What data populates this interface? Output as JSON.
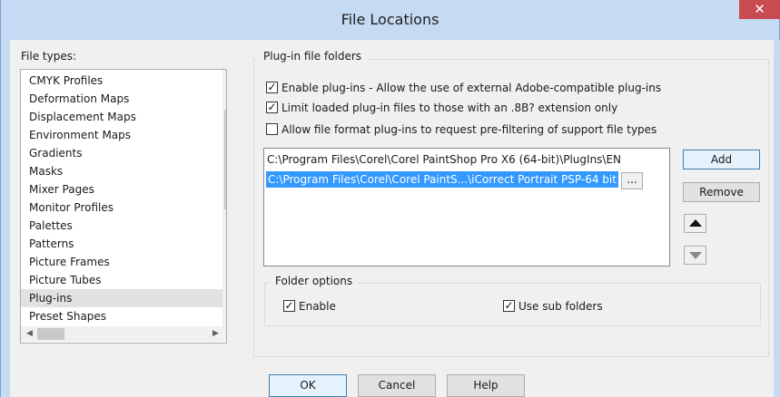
{
  "window": {
    "title": "File Locations",
    "close_glyph": "✕"
  },
  "file_types": {
    "label": "File types:",
    "items": [
      "CMYK Profiles",
      "Deformation Maps",
      "Displacement Maps",
      "Environment Maps",
      "Gradients",
      "Masks",
      "Mixer Pages",
      "Monitor Profiles",
      "Palettes",
      "Patterns",
      "Picture Frames",
      "Picture Tubes",
      "Plug-ins",
      "Preset Shapes"
    ],
    "selected": "Plug-ins"
  },
  "plugin_folders": {
    "group_title": "Plug-in file folders",
    "checkboxes": [
      {
        "label": "Enable plug-ins - Allow the use of external Adobe-compatible plug-ins",
        "checked": true
      },
      {
        "label": "Limit loaded plug-in files to those with an .8B? extension only",
        "checked": true
      },
      {
        "label": "Allow file format plug-ins to request pre-filtering of support file types",
        "checked": false
      }
    ],
    "folders": [
      "C:\\Program Files\\Corel\\Corel PaintShop Pro X6 (64-bit)\\PlugIns\\EN",
      "C:\\Program Files\\Corel\\Corel PaintS...\\iCorrect Portrait PSP-64 bit"
    ],
    "browse_label": "...",
    "add_label": "Add",
    "remove_label": "Remove",
    "move_up_icon": "triangle-up-icon",
    "move_down_icon": "triangle-down-icon"
  },
  "folder_options": {
    "group_title": "Folder options",
    "enable": {
      "label": "Enable",
      "checked": true
    },
    "use_sub_folders": {
      "label": "Use sub folders",
      "checked": true
    }
  },
  "footer": {
    "ok_label": "OK",
    "cancel_label": "Cancel",
    "help_label": "Help"
  },
  "glyphs": {
    "check": "✓",
    "scroll_up": "▲",
    "scroll_down": "▼",
    "scroll_left": "◀",
    "scroll_right": "▶"
  },
  "colors": {
    "titlebar": "#c5daf3",
    "close": "#c74b50",
    "selection": "#3399ff"
  }
}
